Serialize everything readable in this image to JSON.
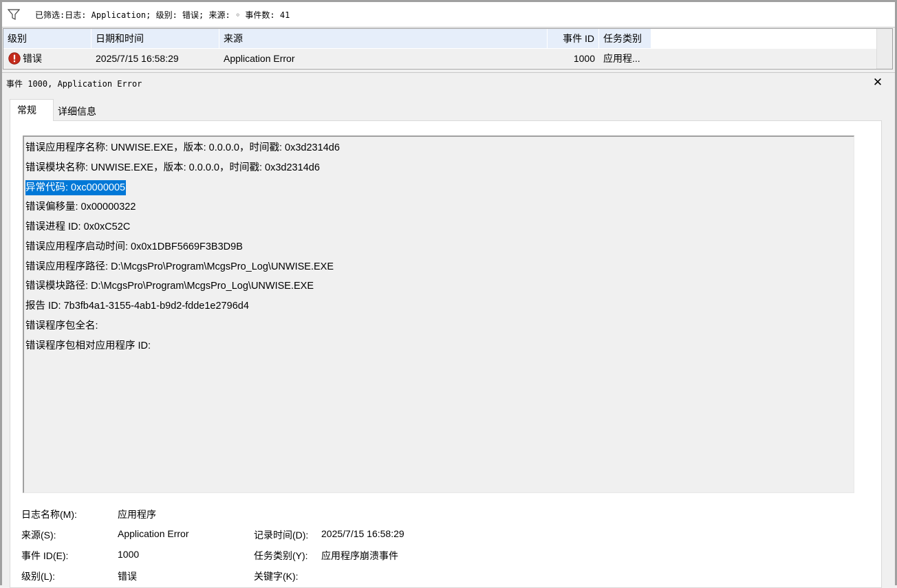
{
  "filter": {
    "text": "已筛选:日志: Application; 级别: 错误; 来源: ◦ 事件数: 41"
  },
  "event_list": {
    "columns": [
      "级别",
      "日期和时间",
      "来源",
      "事件 ID",
      "任务类别"
    ],
    "rows": [
      {
        "level": "错误",
        "datetime": "2025/7/15 16:58:29",
        "source": "Application Error",
        "event_id": "1000",
        "task": "应用程..."
      }
    ]
  },
  "detail": {
    "title": "事件 1000, Application Error",
    "close_glyph": "✕",
    "tabs": [
      "常规",
      "详细信息"
    ],
    "description": [
      "错误应用程序名称: UNWISE.EXE，版本: 0.0.0.0，时间戳: 0x3d2314d6",
      "错误模块名称: UNWISE.EXE，版本: 0.0.0.0，时间戳: 0x3d2314d6",
      "异常代码: 0xc0000005",
      "错误偏移量: 0x00000322",
      "错误进程 ID: 0x0xC52C",
      "错误应用程序启动时间: 0x0x1DBF5669F3B3D9B",
      "错误应用程序路径: D:\\McgsPro\\Program\\McgsPro_Log\\UNWISE.EXE",
      "错误模块路径: D:\\McgsPro\\Program\\McgsPro_Log\\UNWISE.EXE",
      "报告 ID: 7b3fb4a1-3155-4ab1-b9d2-fdde1e2796d4",
      "错误程序包全名:",
      "错误程序包相对应用程序 ID:"
    ],
    "meta": {
      "log_name_label": "日志名称(M):",
      "log_name_value": "应用程序",
      "source_label": "来源(S):",
      "source_value": "Application Error",
      "logged_label": "记录时间(D):",
      "logged_value": "2025/7/15 16:58:29",
      "event_id_label": "事件 ID(E):",
      "event_id_value": "1000",
      "task_label": "任务类别(Y):",
      "task_value": "应用程序崩溃事件",
      "level_label": "级别(L):",
      "level_value": "错误",
      "keywords_label": "关键字(K):"
    }
  },
  "icons": {
    "filter": "filter-icon",
    "error": "error-icon",
    "close": "close-icon"
  },
  "colors": {
    "selection": "#0078d7",
    "header_bg": "#e6eefa",
    "error_red": "#c42b1c"
  }
}
